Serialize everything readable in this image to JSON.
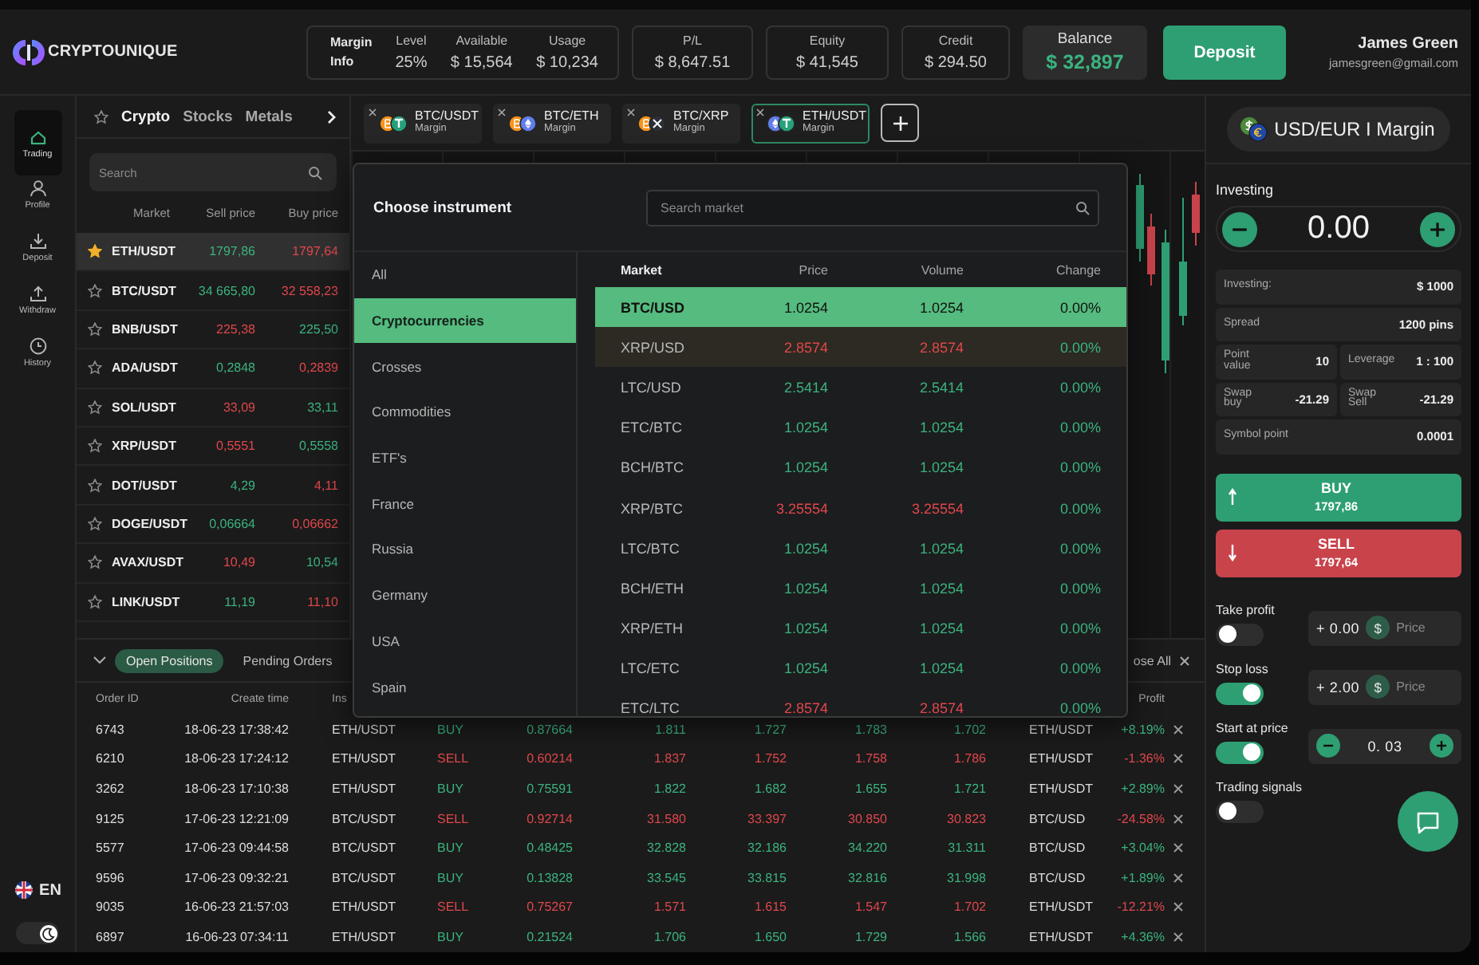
{
  "header": {
    "logo": "CRYPTOUNIQUE",
    "margin": {
      "label": "Margin Info",
      "stats": [
        {
          "label": "Level",
          "value": "25%"
        },
        {
          "label": "Available",
          "value": "$ 15,564"
        },
        {
          "label": "Usage",
          "value": "$ 10,234"
        }
      ]
    },
    "stats": [
      {
        "label": "P/L",
        "value": "$ 8,647.51"
      },
      {
        "label": "Equity",
        "value": "$ 41,545"
      },
      {
        "label": "Credit",
        "value": "$ 294.50"
      }
    ],
    "balance": {
      "label": "Balance",
      "value": "$ 32,897"
    },
    "deposit_button": "Deposit",
    "user": {
      "name": "James Green",
      "email": "jamesgreen@gmail.com"
    }
  },
  "nav": {
    "items": [
      {
        "label": "Trading",
        "kind": "home",
        "selected": true
      },
      {
        "label": "Profile",
        "kind": "user",
        "selected": false
      },
      {
        "label": "Deposit",
        "kind": "download",
        "selected": false
      },
      {
        "label": "Withdraw",
        "kind": "upload",
        "selected": false
      },
      {
        "label": "History",
        "kind": "clock",
        "selected": false
      }
    ],
    "language": "EN",
    "dark_mode": true
  },
  "markets": {
    "tabs": [
      {
        "label": "Crypto",
        "selected": true
      },
      {
        "label": "Stocks",
        "selected": false
      },
      {
        "label": "Metals",
        "selected": false
      }
    ],
    "search_placeholder": "Search",
    "columns": [
      "Market",
      "Sell price",
      "Buy price"
    ],
    "rows": [
      {
        "market": "ETH/USDT",
        "sell": "1797,86",
        "buy": "1797,64",
        "kind": "up",
        "favorite": true,
        "selected": true
      },
      {
        "market": "BTC/USDT",
        "sell": "34 665,80",
        "buy": "32 558,23",
        "kind": "up",
        "favorite": false,
        "selected": false
      },
      {
        "market": "BNB/USDT",
        "sell": "225,38",
        "buy": "225,50",
        "kind": "down",
        "favorite": false,
        "selected": false
      },
      {
        "market": "ADA/USDT",
        "sell": "0,2848",
        "buy": "0,2839",
        "kind": "up",
        "favorite": false,
        "selected": false
      },
      {
        "market": "SOL/USDT",
        "sell": "33,09",
        "buy": "33,11",
        "kind": "down",
        "favorite": false,
        "selected": false
      },
      {
        "market": "XRP/USDT",
        "sell": "0,5551",
        "buy": "0,5558",
        "kind": "down",
        "favorite": false,
        "selected": false
      },
      {
        "market": "DOT/USDT",
        "sell": "4,29",
        "buy": "4,11",
        "kind": "up",
        "favorite": false,
        "selected": false
      },
      {
        "market": "DOGE/USDT",
        "sell": "0,06664",
        "buy": "0,06662",
        "kind": "up",
        "favorite": false,
        "selected": false
      },
      {
        "market": "AVAX/USDT",
        "sell": "10,49",
        "buy": "10,54",
        "kind": "down",
        "favorite": false,
        "selected": false
      },
      {
        "market": "LINK/USDT",
        "sell": "11,19",
        "buy": "11,10",
        "kind": "up",
        "favorite": false,
        "selected": false
      }
    ]
  },
  "chart_tabs": [
    {
      "pair": "BTC/USDT",
      "type": "Margin",
      "selected": false
    },
    {
      "pair": "BTC/ETH",
      "type": "Margin",
      "selected": false
    },
    {
      "pair": "BTC/XRP",
      "type": "Margin",
      "selected": false
    },
    {
      "pair": "ETH/USDT",
      "type": "Margin",
      "selected": true
    }
  ],
  "positions": {
    "tabs": [
      {
        "label": "Open Positions",
        "selected": true
      },
      {
        "label": "Pending Orders",
        "selected": false
      }
    ],
    "close_all": "ose All",
    "columns": [
      "Order ID",
      "Create time",
      "Ins"
    ],
    "profit_column": "Profit",
    "rows": [
      {
        "id": "6743",
        "created": "18-06-23 17:38:42",
        "instrument": "ETH/USDT",
        "side": "BUY",
        "kind": "buy",
        "amount": "0.87664",
        "values": [
          "1.811",
          "1.727",
          "1.783",
          "1.702"
        ],
        "symbol": "ETH/USDT",
        "profit": "+8.19%"
      },
      {
        "id": "6210",
        "created": "18-06-23 17:24:12",
        "instrument": "ETH/USDT",
        "side": "SELL",
        "kind": "sell",
        "amount": "0.60214",
        "values": [
          "1.837",
          "1.752",
          "1.758",
          "1.786"
        ],
        "symbol": "ETH/USDT",
        "profit": "-1.36%"
      },
      {
        "id": "3262",
        "created": "18-06-23 17:10:38",
        "instrument": "ETH/USDT",
        "side": "BUY",
        "kind": "buy",
        "amount": "0.75591",
        "values": [
          "1.822",
          "1.682",
          "1.655",
          "1.721"
        ],
        "symbol": "ETH/USDT",
        "profit": "+2.89%"
      },
      {
        "id": "9125",
        "created": "17-06-23 12:21:09",
        "instrument": "BTC/USDT",
        "side": "SELL",
        "kind": "sell",
        "amount": "0.92714",
        "values": [
          "31.580",
          "33.397",
          "30.850",
          "30.823"
        ],
        "symbol": "BTC/USD",
        "profit": "-24.58%"
      },
      {
        "id": "5577",
        "created": "17-06-23 09:44:58",
        "instrument": "BTC/USDT",
        "side": "BUY",
        "kind": "buy",
        "amount": "0.48425",
        "values": [
          "32.828",
          "32.186",
          "34.220",
          "31.311"
        ],
        "symbol": "BTC/USD",
        "profit": "+3.04%"
      },
      {
        "id": "9596",
        "created": "17-06-23 09:32:21",
        "instrument": "BTC/USDT",
        "side": "BUY",
        "kind": "buy",
        "amount": "0.13828",
        "values": [
          "33.545",
          "33.815",
          "32.816",
          "31.998"
        ],
        "symbol": "BTC/USD",
        "profit": "+1.89%"
      },
      {
        "id": "9035",
        "created": "16-06-23 21:57:03",
        "instrument": "ETH/USDT",
        "side": "SELL",
        "kind": "sell",
        "amount": "0.75267",
        "values": [
          "1.571",
          "1.615",
          "1.547",
          "1.702"
        ],
        "symbol": "ETH/USDT",
        "profit": "-12.21%"
      },
      {
        "id": "6897",
        "created": "16-06-23 07:34:11",
        "instrument": "ETH/USDT",
        "side": "BUY",
        "kind": "buy",
        "amount": "0.21524",
        "values": [
          "1.706",
          "1.650",
          "1.729",
          "1.566"
        ],
        "symbol": "ETH/USDT",
        "profit": "+4.36%"
      }
    ]
  },
  "modal": {
    "title": "Choose instrument",
    "search_placeholder": "Search market",
    "categories": [
      {
        "label": "All",
        "selected": false
      },
      {
        "label": "Cryptocurrencies",
        "selected": true
      },
      {
        "label": "Crosses",
        "selected": false
      },
      {
        "label": "Commodities",
        "selected": false
      },
      {
        "label": "ETF's",
        "selected": false
      },
      {
        "label": "France",
        "selected": false
      },
      {
        "label": "Russia",
        "selected": false
      },
      {
        "label": "Germany",
        "selected": false
      },
      {
        "label": "USA",
        "selected": false
      },
      {
        "label": "Spain",
        "selected": false
      }
    ],
    "columns": [
      "Market",
      "Price",
      "Volume",
      "Change"
    ],
    "rows": [
      {
        "market": "BTC/USD",
        "price": "1.0254",
        "volume": "1.0254",
        "change": "0.00%",
        "kind": "up",
        "selected": true,
        "highlighted": false
      },
      {
        "market": "XRP/USD",
        "price": "2.8574",
        "volume": "2.8574",
        "change": "0.00%",
        "kind": "down",
        "selected": false,
        "highlighted": true
      },
      {
        "market": "LTC/USD",
        "price": "2.5414",
        "volume": "2.5414",
        "change": "0.00%",
        "kind": "up",
        "selected": false,
        "highlighted": false
      },
      {
        "market": "ETC/BTC",
        "price": "1.0254",
        "volume": "1.0254",
        "change": "0.00%",
        "kind": "up",
        "selected": false,
        "highlighted": false
      },
      {
        "market": "BCH/BTC",
        "price": "1.0254",
        "volume": "1.0254",
        "change": "0.00%",
        "kind": "up",
        "selected": false,
        "highlighted": false
      },
      {
        "market": "XRP/BTC",
        "price": "3.25554",
        "volume": "3.25554",
        "change": "0.00%",
        "kind": "down",
        "selected": false,
        "highlighted": false
      },
      {
        "market": "LTC/BTC",
        "price": "1.0254",
        "volume": "1.0254",
        "change": "0.00%",
        "kind": "up",
        "selected": false,
        "highlighted": false
      },
      {
        "market": "BCH/ETH",
        "price": "1.0254",
        "volume": "1.0254",
        "change": "0.00%",
        "kind": "up",
        "selected": false,
        "highlighted": false
      },
      {
        "market": "XRP/ETH",
        "price": "1.0254",
        "volume": "1.0254",
        "change": "0.00%",
        "kind": "up",
        "selected": false,
        "highlighted": false
      },
      {
        "market": "LTC/ETC",
        "price": "1.0254",
        "volume": "1.0254",
        "change": "0.00%",
        "kind": "up",
        "selected": false,
        "highlighted": false
      },
      {
        "market": "ETC/LTC",
        "price": "2.8574",
        "volume": "2.8574",
        "change": "0.00%",
        "kind": "down",
        "selected": false,
        "highlighted": false
      }
    ]
  },
  "trade": {
    "pair": "USD/EUR I Margin",
    "investing_label": "Investing",
    "amount": "0.00",
    "details": [
      {
        "label": "Investing:",
        "value": "$ 1000",
        "kind": "wide"
      },
      {
        "label": "Spread",
        "value": "1200 pins",
        "kind": "wide"
      },
      {
        "label": "Point value",
        "value": "10",
        "kind": "half"
      },
      {
        "label": "Leverage",
        "value": "1 : 100",
        "kind": "half"
      },
      {
        "label": "Swap buy",
        "value": "-21.29",
        "kind": "half"
      },
      {
        "label": "Swap Sell",
        "value": "-21.29",
        "kind": "half"
      },
      {
        "label": "Symbol point",
        "value": "0.0001",
        "kind": "wide"
      }
    ],
    "buy": {
      "label": "BUY",
      "price": "1797,86"
    },
    "sell": {
      "label": "SELL",
      "price": "1797,64"
    },
    "options": [
      {
        "label": "Take profit",
        "on": false,
        "kind": "price",
        "value": "+ 0.00",
        "currency": "$",
        "placeholder": "Price"
      },
      {
        "label": "Stop loss",
        "on": true,
        "kind": "price",
        "value": "+ 2.00",
        "currency": "$",
        "placeholder": "Price"
      },
      {
        "label": "Start at price",
        "on": true,
        "kind": "stepper",
        "value": "0. 03"
      },
      {
        "label": "Trading signals",
        "on": false,
        "kind": "plain"
      }
    ]
  }
}
